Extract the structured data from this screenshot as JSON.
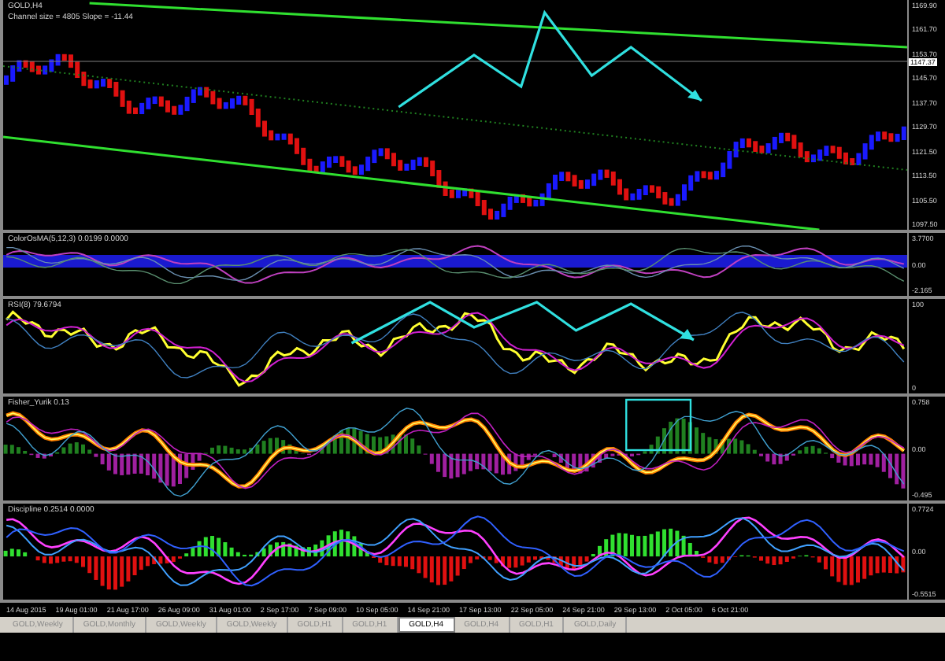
{
  "chart_title": "GOLD,H4",
  "channel_info": "Channel size = 4805  Slope = -11.44",
  "price_axis": [
    "1169.90",
    "1161.70",
    "1153.70",
    "1145.70",
    "1137.70",
    "1129.70",
    "1121.50",
    "1113.50",
    "1105.50",
    "1097.50"
  ],
  "current_price": "1147.37",
  "panels": [
    {
      "kind": "osma",
      "title": "ColorOsMA(5,12,3) 0.0199 0.0000",
      "axis": [
        "3.7700",
        "0.00",
        "-2.165"
      ]
    },
    {
      "kind": "rsi",
      "title": "RSI(8) 79.6794",
      "axis": [
        "100",
        "0"
      ]
    },
    {
      "kind": "fisher",
      "title": "Fisher_Yurik 0.13",
      "axis": [
        "0.758",
        "0.00",
        "-0.495"
      ]
    },
    {
      "kind": "discipline",
      "title": "Discipline 0.2514 0.0000",
      "axis": [
        "0.7724",
        "0.00",
        "-0.5515"
      ]
    }
  ],
  "time_axis": [
    "14 Aug 2015",
    "19 Aug 01:00",
    "21 Aug 17:00",
    "26 Aug 09:00",
    "31 Aug 01:00",
    "2 Sep 17:00",
    "7 Sep 09:00",
    "10 Sep 05:00",
    "14 Sep 21:00",
    "17 Sep 13:00",
    "22 Sep 05:00",
    "24 Sep 21:00",
    "29 Sep 13:00",
    "2 Oct 05:00",
    "6 Oct 21:00"
  ],
  "tabs": [
    {
      "label": "GOLD,Weekly",
      "selected": false
    },
    {
      "label": "GOLD,Monthly",
      "selected": false
    },
    {
      "label": "GOLD,Weekly",
      "selected": false
    },
    {
      "label": "GOLD,Weekly",
      "selected": false
    },
    {
      "label": "GOLD,H1",
      "selected": false
    },
    {
      "label": "GOLD,H1",
      "selected": false
    },
    {
      "label": "GOLD,H4",
      "selected": true
    },
    {
      "label": "GOLD,H4",
      "selected": false
    },
    {
      "label": "GOLD,H1",
      "selected": false
    },
    {
      "label": "GOLD,Daily",
      "selected": false
    }
  ]
}
